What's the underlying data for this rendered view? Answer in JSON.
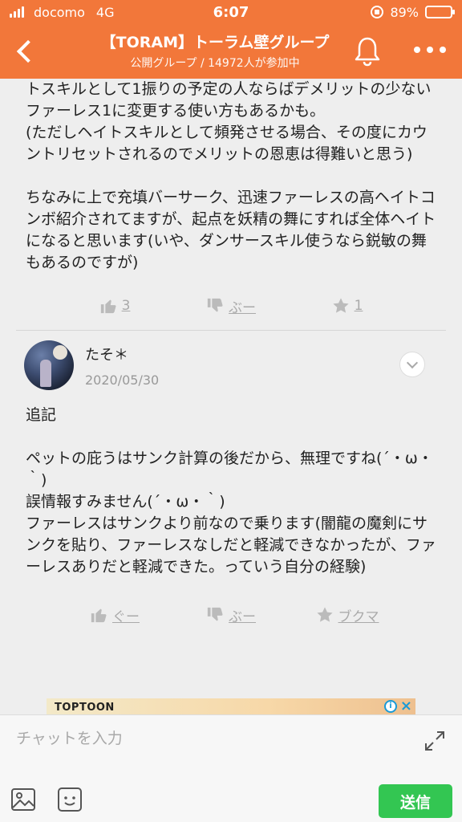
{
  "status_bar": {
    "carrier": "docomo",
    "network": "4G",
    "time": "6:07",
    "battery_percent": "89%",
    "battery_level": 0.89
  },
  "header": {
    "title": "【TORAM】トーラム壁グループ",
    "subtitle": "公開グループ / 14972人が参加中"
  },
  "post1": {
    "body": "トスキルとして1振りの予定の人ならばデメリットの少ないファーレス1に変更する使い方もあるかも。\n(ただしヘイトスキルとして頻発させる場合、その度にカウントリセットされるのでメリットの恩恵は得難いと思う)\n\nちなみに上で充填バーサーク、迅速ファーレスの高ヘイトコンボ紹介されてますが、起点を妖精の舞にすれば全体ヘイトになると思います(いや、ダンサースキル使うなら鋭敏の舞もあるのですが)",
    "like_label": "3",
    "dislike_label": "ぶー",
    "favorite_label": "1"
  },
  "comment": {
    "username": "たそ＊",
    "date": "2020/05/30",
    "body": "追記\n\nペットの庇うはサンク計算の後だから、無理ですね(´・ω・｀)\n誤情報すみません(´・ω・｀)\nファーレスはサンクより前なので乗ります(闇龍の魔剣にサンクを貼り、ファーレスなしだと軽減できなかったが、ファーレスありだと軽減できた。っていう自分の経験)",
    "like_label": "ぐー",
    "dislike_label": "ぶー",
    "favorite_label": "ブクマ"
  },
  "ad": {
    "logo_text": "TOPTOON",
    "info_icon": "i",
    "close_icon": "×"
  },
  "chat": {
    "placeholder": "チャットを入力",
    "send_label": "送信"
  },
  "colors": {
    "header_bg": "#f2773a",
    "send_bg": "#33c652"
  }
}
